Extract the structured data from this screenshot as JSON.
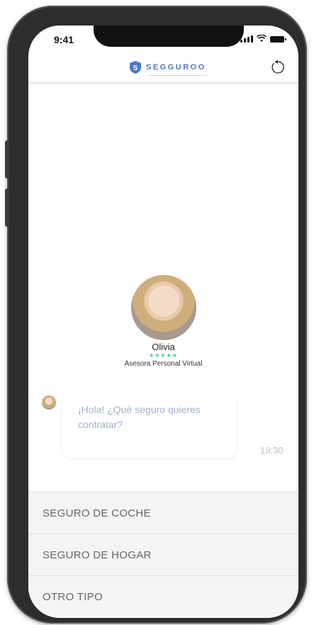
{
  "status_bar": {
    "time": "9:41"
  },
  "header": {
    "brand_name": "SEGGUROO",
    "brand_logo_letter": "S"
  },
  "agent": {
    "name": "Olivia",
    "stars": "★★★★★",
    "role": "Asesora Personal Virtual"
  },
  "messages": [
    {
      "text": "¡Hola! ¿Qué seguro quieres contratar?",
      "time": "19:30"
    }
  ],
  "options": [
    {
      "label": "SEGURO DE COCHE"
    },
    {
      "label": "SEGURO DE HOGAR"
    },
    {
      "label": "OTRO TIPO"
    }
  ],
  "colors": {
    "brand": "#4a78c8",
    "stars": "#3ec9a7",
    "message_text": "#9fb2cc"
  }
}
